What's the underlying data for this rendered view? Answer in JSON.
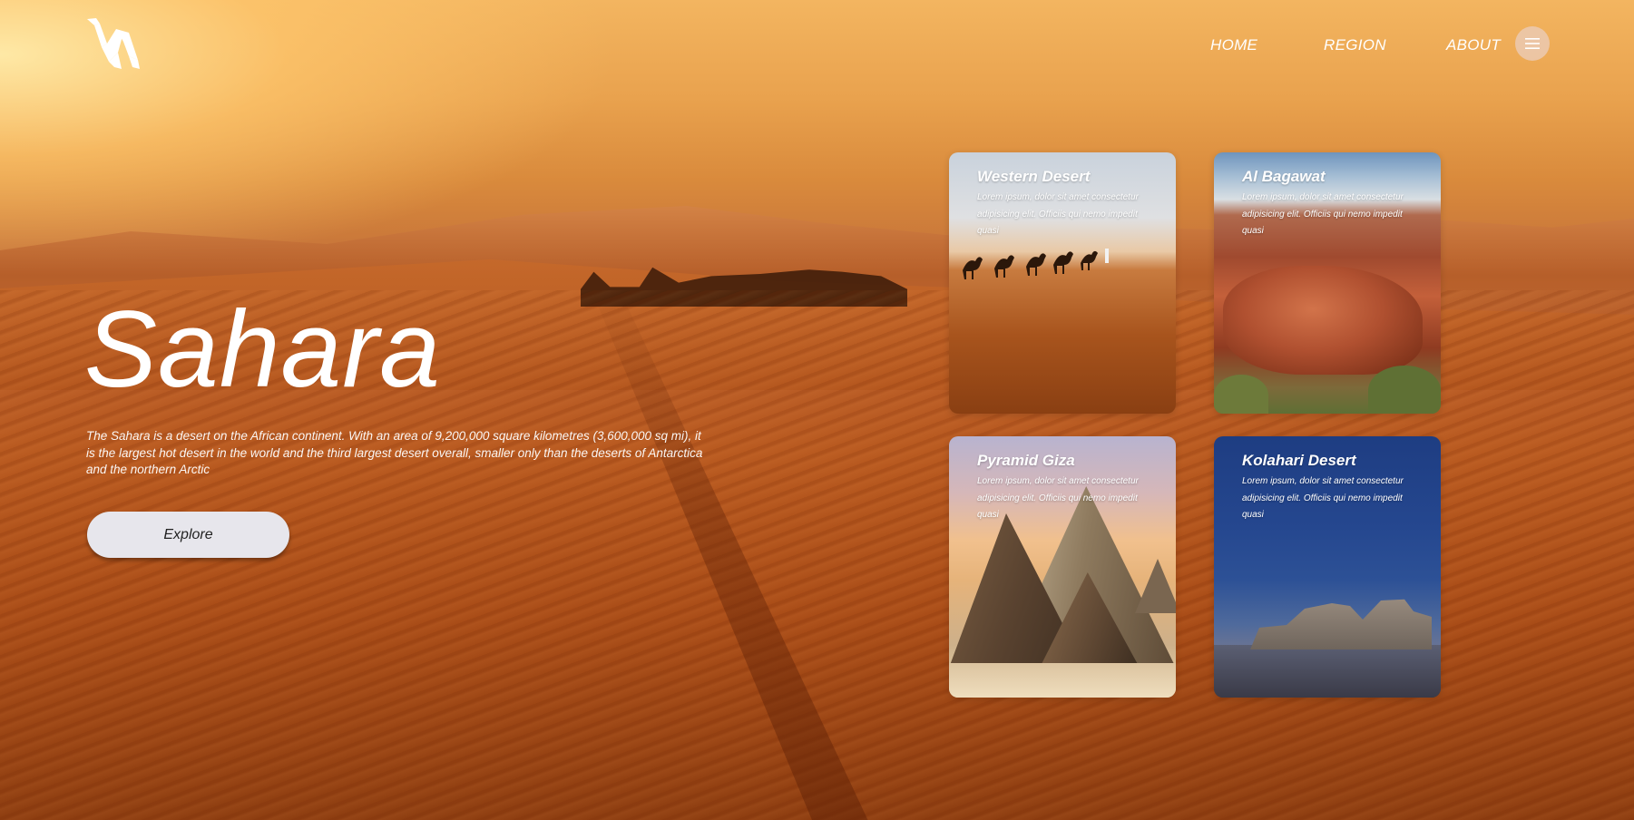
{
  "brand": {
    "logo_icon": "camel-origami-logo-icon"
  },
  "nav": {
    "items": [
      {
        "label": "HOME"
      },
      {
        "label": "REGION"
      },
      {
        "label": "ABOUT"
      }
    ],
    "menu_icon": "hamburger-menu-icon"
  },
  "hero": {
    "title": "Sahara",
    "description": "The Sahara is a desert on the African continent. With an area of 9,200,000 square kilometres (3,600,000 sq mi), it is the largest hot desert in the world and the third largest desert overall, smaller only than the deserts of Antarctica and the northern Arctic",
    "button_label": "Explore"
  },
  "cards": [
    {
      "title": "Western Desert",
      "text": "Lorem ipsum, dolor sit amet consectetur adipisicing elit. Officiis qui nemo impedit quasi"
    },
    {
      "title": "Al Bagawat",
      "text": "Lorem ipsum, dolor sit amet consectetur adipisicing elit. Officiis qui nemo impedit quasi"
    },
    {
      "title": "Pyramid Giza",
      "text": "Lorem ipsum, dolor sit amet consectetur adipisicing elit. Officiis qui nemo impedit quasi"
    },
    {
      "title": "Kolahari Desert",
      "text": "Lorem ipsum, dolor sit amet consectetur adipisicing elit. Officiis qui nemo impedit quasi"
    }
  ],
  "colors": {
    "text": "#ffffff",
    "button_bg": "#e7e6ec",
    "menu_btn_bg": "#ebcdbe"
  }
}
